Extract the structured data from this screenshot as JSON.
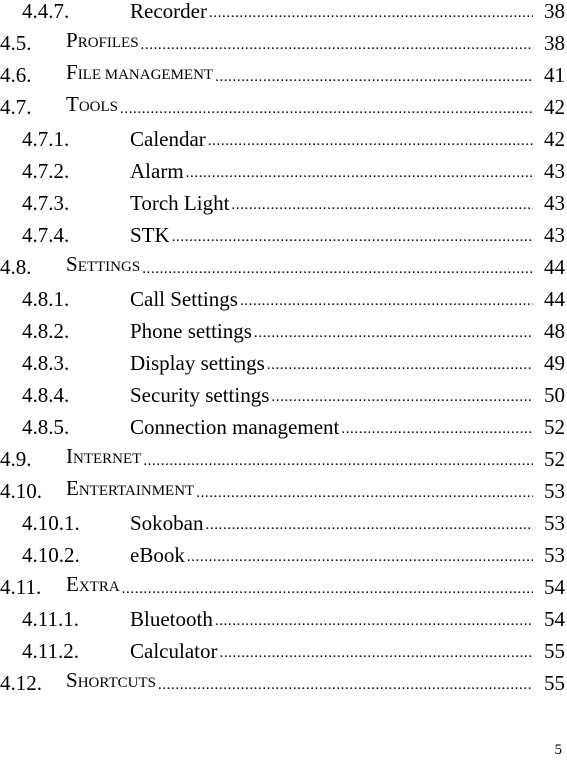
{
  "toc": [
    {
      "level": 2,
      "number": "4.4.7.",
      "title": "Recorder",
      "page": "38"
    },
    {
      "level": 1,
      "number": "4.5.",
      "title_first": "P",
      "title_rest": "ROFILES",
      "page": "38"
    },
    {
      "level": 1,
      "number": "4.6.",
      "title_first": "F",
      "title_rest": "ILE MANAGEMENT",
      "page": "41"
    },
    {
      "level": 1,
      "number": "4.7.",
      "title_first": "T",
      "title_rest": "OOLS",
      "page": "42"
    },
    {
      "level": 2,
      "number": "4.7.1.",
      "title": "Calendar",
      "page": "42"
    },
    {
      "level": 2,
      "number": "4.7.2.",
      "title": "Alarm",
      "page": "43"
    },
    {
      "level": 2,
      "number": "4.7.3.",
      "title": "Torch Light",
      "page": "43"
    },
    {
      "level": 2,
      "number": "4.7.4.",
      "title": "STK",
      "page": "43"
    },
    {
      "level": 1,
      "number": "4.8.",
      "title_first": "S",
      "title_rest": "ETTINGS",
      "page": "44"
    },
    {
      "level": 2,
      "number": "4.8.1.",
      "title": "Call Settings",
      "page": "44"
    },
    {
      "level": 2,
      "number": "4.8.2.",
      "title": "Phone settings",
      "page": "48"
    },
    {
      "level": 2,
      "number": "4.8.3.",
      "title": "Display settings",
      "page": "49"
    },
    {
      "level": 2,
      "number": "4.8.4.",
      "title": "Security settings",
      "page": "50"
    },
    {
      "level": 2,
      "number": "4.8.5.",
      "title": "Connection management",
      "page": "52"
    },
    {
      "level": 1,
      "number": "4.9.",
      "title_first": "I",
      "title_rest": "NTERNET",
      "page": "52"
    },
    {
      "level": 1,
      "number": "4.10.",
      "title_first": "E",
      "title_rest": "NTERTAINMENT",
      "page": "53"
    },
    {
      "level": 2,
      "number": "4.10.1.",
      "title": "Sokoban",
      "page": "53"
    },
    {
      "level": 2,
      "number": "4.10.2.",
      "title": "eBook",
      "page": "53"
    },
    {
      "level": 1,
      "number": "4.11.",
      "title_first": "E",
      "title_rest": "XTRA",
      "page": "54"
    },
    {
      "level": 2,
      "number": "4.11.1.",
      "title": "Bluetooth",
      "page": "54"
    },
    {
      "level": 2,
      "number": "4.11.2.",
      "title": "Calculator",
      "page": "55"
    },
    {
      "level": 1,
      "number": "4.12.",
      "title_first": "S",
      "title_rest": "HORTCUTS",
      "page": "55"
    }
  ],
  "page_number": "5"
}
